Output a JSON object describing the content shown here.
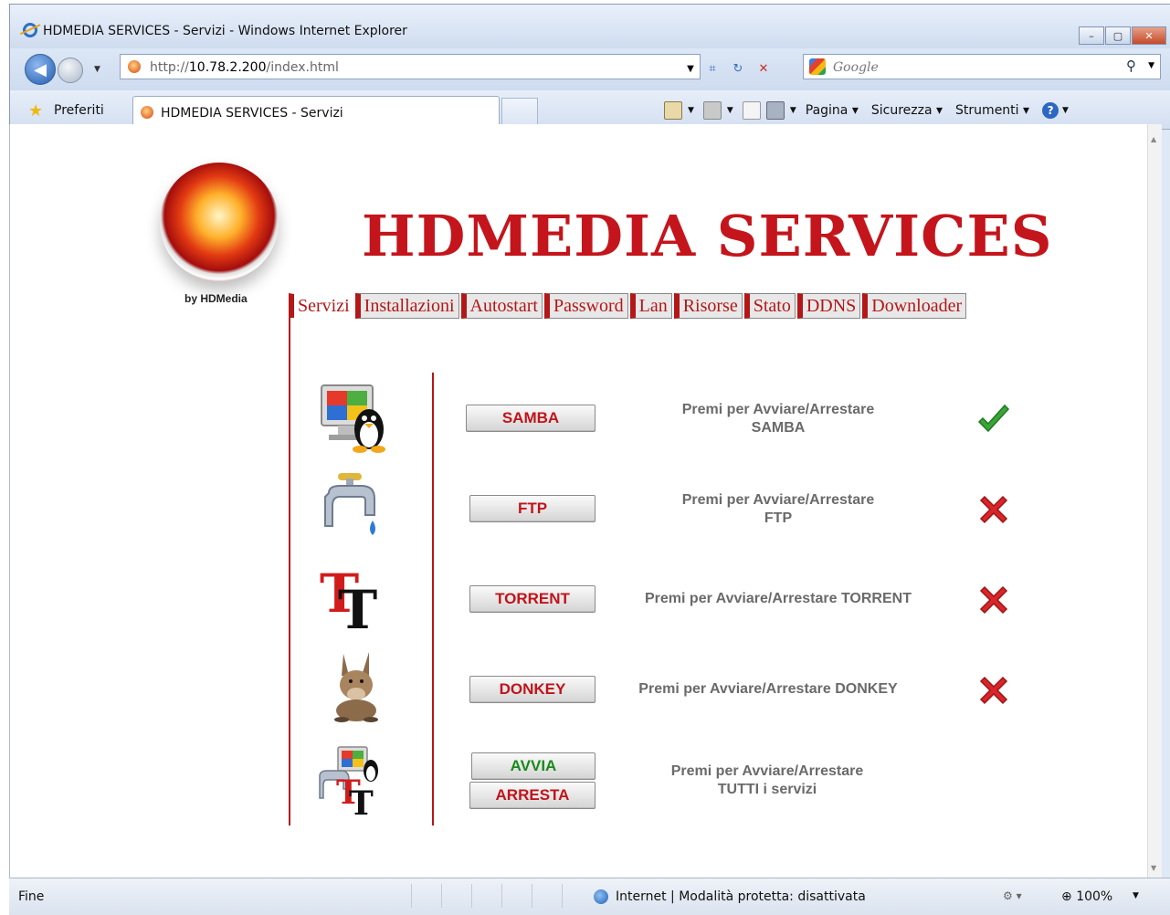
{
  "browser": {
    "window_title": "HDMEDIA SERVICES - Servizi - Windows Internet Explorer",
    "address_prefix": "http://",
    "address_host": "10.78.2.200",
    "address_path": "/index.html",
    "search_placeholder": "Google",
    "favorites_label": "Preferiti",
    "tab_title": "HDMEDIA SERVICES - Servizi",
    "menus": [
      "Pagina",
      "Sicurezza",
      "Strumenti"
    ],
    "status_left": "Fine",
    "status_zone": "Internet | Modalità protetta: disattivata",
    "zoom": "100%"
  },
  "page": {
    "logo_caption": "by HDMedia",
    "brand_title": "HDMEDIA SERVICES",
    "nav_tabs": [
      "Servizi",
      "Installazioni",
      "Autostart",
      "Password",
      "Lan",
      "Risorse",
      "Stato",
      "DDNS",
      "Downloader"
    ],
    "active_tab": "Servizi",
    "services": [
      {
        "button": "SAMBA",
        "desc_line1": "Premi per Avviare/Arrestare",
        "desc_line2": "SAMBA",
        "status": "running",
        "icon": "samba-linux-icon"
      },
      {
        "button": "FTP",
        "desc_line1": "Premi per Avviare/Arrestare",
        "desc_line2": "FTP",
        "status": "stopped",
        "icon": "ftp-faucet-icon"
      },
      {
        "button": "TORRENT",
        "desc_line1": "Premi per Avviare/Arrestare TORRENT",
        "desc_line2": "",
        "status": "stopped",
        "icon": "torrent-icon"
      },
      {
        "button": "DONKEY",
        "desc_line1": "Premi per Avviare/Arrestare DONKEY",
        "desc_line2": "",
        "status": "stopped",
        "icon": "donkey-icon"
      }
    ],
    "all_services": {
      "start_label": "AVVIA",
      "stop_label": "ARRESTA",
      "desc_line1": "Premi per Avviare/Arrestare",
      "desc_line2": "TUTTI i servizi",
      "icon": "all-services-icon"
    },
    "colors": {
      "brand_red": "#c4151c",
      "running_green": "#3aa53a",
      "stopped_red": "#d8262a",
      "start_green": "#1a8a1a"
    }
  }
}
